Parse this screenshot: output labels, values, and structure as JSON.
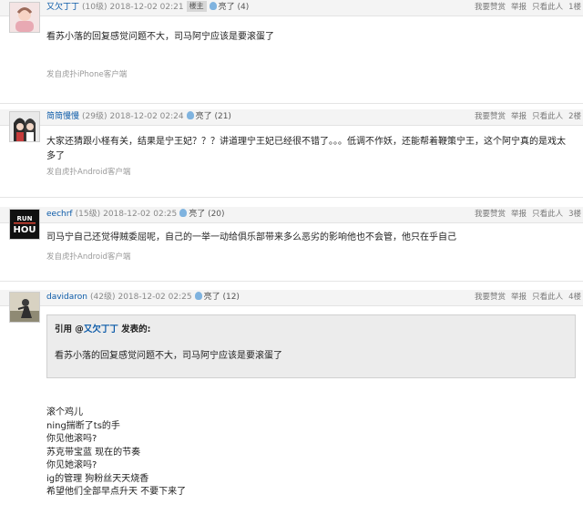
{
  "posts": [
    {
      "username": "又欠丁丁",
      "level": "(10级)",
      "time": "2018-12-02 02:21",
      "badge": "楼主",
      "light": "亮了 (4)",
      "actions": [
        "我要赞赏",
        "举报",
        "只看此人",
        "1楼"
      ],
      "content": "看苏小落的回复感觉问题不大，司马阿宁应该是要滚蛋了",
      "source": "发自虎扑iPhone客户端"
    },
    {
      "username": "简简慢慢",
      "level": "(29级)",
      "time": "2018-12-02 02:24",
      "light": "亮了 (21)",
      "actions": [
        "我要赞赏",
        "举报",
        "只看此人",
        "2楼"
      ],
      "content": "大家还猜跟小柽有关，结果是宁王妃？？？讲道理宁王妃已经很不错了。。。低调不作妖，还能帮着鞭策宁王，这个阿宁真的是戏太多了",
      "source": "发自虎扑Android客户端"
    },
    {
      "username": "eechrf",
      "level": "(15级)",
      "time": "2018-12-02 02:25",
      "light": "亮了 (20)",
      "avatar_text": [
        "RUN",
        "HOU"
      ],
      "actions": [
        "我要赞赏",
        "举报",
        "只看此人",
        "3楼"
      ],
      "content": "司马宁自己还觉得贼委屈呢，自己的一举一动给俱乐部带来多么恶劣的影响他也不会管，他只在乎自己",
      "source": "发自虎扑Android客户端"
    },
    {
      "username": "davidaron",
      "level": "(42级)",
      "time": "2018-12-02 02:25",
      "light": "亮了 (12)",
      "actions": [
        "我要赞赏",
        "举报",
        "只看此人",
        "4楼"
      ],
      "quote": {
        "prefix": "引用 @",
        "user": "又欠丁丁",
        "suffix": " 发表的:",
        "text": "看苏小落的回复感觉问题不大，司马阿宁应该是要滚蛋了"
      },
      "lines": [
        "滚个鸡儿",
        "ning揣断了ts的手",
        "你见他滚吗?",
        "苏克带宝蓝 现在的节奏",
        "你见她滚吗?",
        "ig的管理 狗粉丝天天烧香",
        "希望他们全部早点升天 不要下来了"
      ]
    }
  ]
}
